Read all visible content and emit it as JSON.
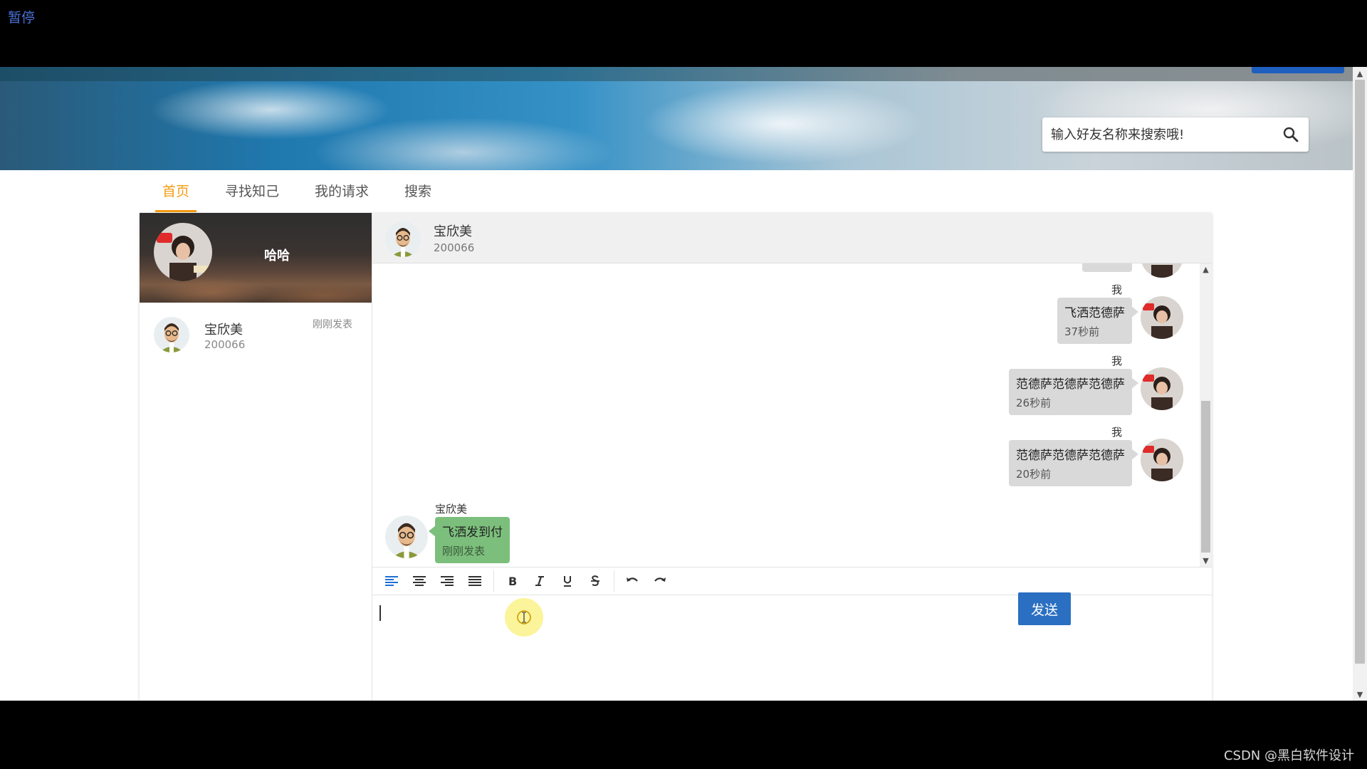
{
  "overlay": {
    "pause_label": "暂停",
    "watermark": "CSDN @黑白软件设计"
  },
  "search": {
    "placeholder": "输入好友名称来搜索哦!"
  },
  "tabs": [
    {
      "label": "首页",
      "active": true
    },
    {
      "label": "寻找知己"
    },
    {
      "label": "我的请求"
    },
    {
      "label": "搜索"
    }
  ],
  "profile": {
    "name": "哈哈"
  },
  "contacts": [
    {
      "name": "宝欣美",
      "id": "200066",
      "time": "刚刚发表"
    }
  ],
  "chat": {
    "header": {
      "name": "宝欣美",
      "id": "200066"
    },
    "messages": [
      {
        "side": "right",
        "sender": "我",
        "text": "飞洒范德萨",
        "time": "37秒前"
      },
      {
        "side": "right",
        "sender": "我",
        "text": "范德萨范德萨范德萨",
        "time": "26秒前"
      },
      {
        "side": "right",
        "sender": "我",
        "text": "范德萨范德萨范德萨",
        "time": "20秒前"
      },
      {
        "side": "left",
        "sender": "宝欣美",
        "text": "飞洒发到付",
        "time": "刚刚发表"
      }
    ]
  },
  "editor": {
    "send_label": "发送"
  },
  "colors": {
    "accent_tab": "#f39c12",
    "send_button": "#2a6fc1",
    "received_bubble": "#7cbf7c",
    "sent_bubble": "#d9d9d9"
  }
}
